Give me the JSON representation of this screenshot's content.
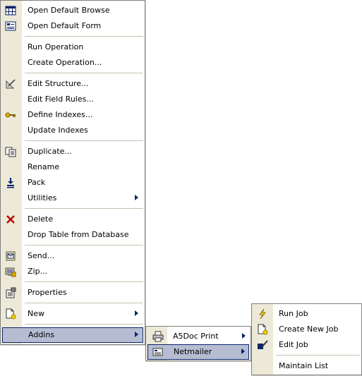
{
  "main_menu": {
    "items": [
      {
        "label": "Open Default Browse",
        "icon": "browse-grid-icon"
      },
      {
        "label": "Open Default Form",
        "icon": "form-icon"
      },
      {
        "label": "Run Operation"
      },
      {
        "label": "Create Operation..."
      },
      {
        "label": "Edit Structure...",
        "icon": "edit-structure-icon"
      },
      {
        "label": "Edit Field Rules..."
      },
      {
        "label": "Define Indexes...",
        "icon": "key-icon"
      },
      {
        "label": "Update Indexes"
      },
      {
        "label": "Duplicate...",
        "icon": "duplicate-icon"
      },
      {
        "label": "Rename"
      },
      {
        "label": "Pack",
        "icon": "pack-icon"
      },
      {
        "label": "Utilities",
        "has_submenu": true
      },
      {
        "label": "Delete",
        "icon": "delete-x-icon"
      },
      {
        "label": "Drop Table from Database"
      },
      {
        "label": "Send...",
        "icon": "send-icon"
      },
      {
        "label": "Zip...",
        "icon": "zip-icon"
      },
      {
        "label": "Properties",
        "icon": "properties-icon"
      },
      {
        "label": "New",
        "icon": "new-icon",
        "has_submenu": true
      },
      {
        "label": "Addins",
        "has_submenu": true,
        "highlighted": true
      }
    ]
  },
  "addins_menu": {
    "items": [
      {
        "label": "A5Doc Print",
        "icon": "printer-icon",
        "has_submenu": true
      },
      {
        "label": "Netmailer",
        "icon": "netmailer-icon",
        "has_submenu": true,
        "highlighted": true
      }
    ]
  },
  "netmailer_menu": {
    "items": [
      {
        "label": "Run Job",
        "icon": "lightning-icon"
      },
      {
        "label": "Create New Job",
        "icon": "new-job-icon"
      },
      {
        "label": "Edit Job",
        "icon": "edit-job-icon"
      },
      {
        "label": "Maintain List"
      }
    ]
  },
  "colors": {
    "highlight_bg": "#b6bdd2",
    "highlight_border": "#0a246a",
    "gutter": "#ece9d8",
    "delete_red": "#c00000"
  }
}
